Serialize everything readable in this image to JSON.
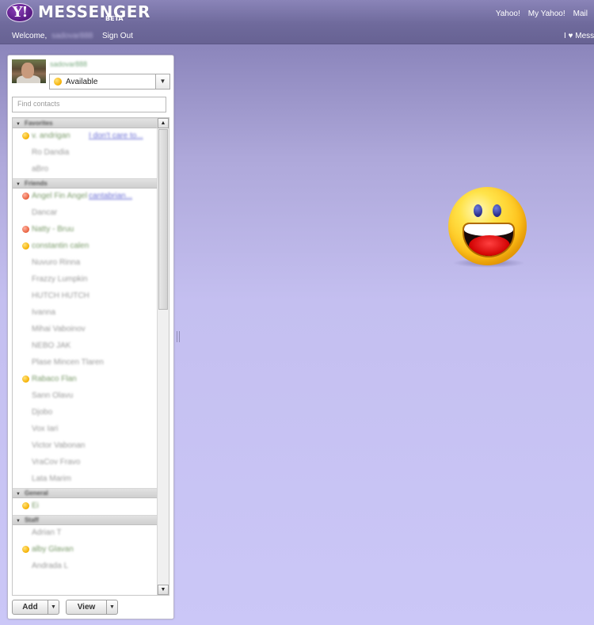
{
  "header": {
    "logo_mark": "Y!",
    "logo_text": "MESSENGER",
    "beta_label": "BETA",
    "links": [
      "Yahoo!",
      "My Yahoo!",
      "Mail"
    ],
    "welcome_label": "Welcome,",
    "username": "sadovar888",
    "sign_out": "Sign Out",
    "promo": "I ♥ Messenger"
  },
  "profile": {
    "display_name": "sadovar888",
    "status": "Available"
  },
  "search": {
    "placeholder": "Find contacts"
  },
  "groups": [
    {
      "name": "Favorites",
      "contacts": [
        {
          "name": "v. andrigan",
          "status": "online",
          "message": "I don't care to..."
        },
        {
          "name": "Ro Dandia",
          "status": "offline"
        },
        {
          "name": "aBro",
          "status": "offline"
        }
      ]
    },
    {
      "name": "Friends",
      "contacts": [
        {
          "name": "Angel Fin Angel",
          "status": "busy",
          "message": "cantabrian..."
        },
        {
          "name": "Dancar",
          "status": "offline"
        },
        {
          "name": "Natty - Bruu",
          "status": "busy"
        },
        {
          "name": "constantin calen",
          "status": "online"
        },
        {
          "name": "Nuvuro Rinna",
          "status": "offline"
        },
        {
          "name": "Frazzy Lumpkin",
          "status": "offline"
        },
        {
          "name": "HUTCH HUTCH",
          "status": "offline"
        },
        {
          "name": "Ivanna",
          "status": "offline"
        },
        {
          "name": "Mihai Vaboinov",
          "status": "offline"
        },
        {
          "name": "NEBO JAK",
          "status": "offline"
        },
        {
          "name": "Plase Mincen Tlaren",
          "status": "offline"
        },
        {
          "name": "Rabaco Flan",
          "status": "online"
        },
        {
          "name": "Sann Olavu",
          "status": "offline"
        },
        {
          "name": "Djobo",
          "status": "offline"
        },
        {
          "name": "Vox Iari",
          "status": "offline"
        },
        {
          "name": "Victor Vabonan",
          "status": "offline"
        },
        {
          "name": "VraCov Fravo",
          "status": "offline"
        },
        {
          "name": "Lata Marim",
          "status": "offline"
        }
      ]
    },
    {
      "name": "General",
      "contacts": [
        {
          "name": "Ei",
          "status": "online"
        }
      ]
    },
    {
      "name": "Staff",
      "contacts": [
        {
          "name": "Adrian T",
          "status": "offline"
        },
        {
          "name": "alby Glavan",
          "status": "online"
        },
        {
          "name": "Andrada L",
          "status": "offline"
        }
      ]
    }
  ],
  "buttons": {
    "add": "Add",
    "view": "View"
  },
  "icons": {
    "status": "status-dot-icon",
    "dropdown": "chevron-down-icon",
    "scroll_up": "triangle-up-icon",
    "scroll_down": "triangle-down-icon",
    "group_toggle": "triangle-down-icon",
    "mascot": "smiley-face-icon"
  },
  "colors": {
    "header_bg": "#6f6a9c",
    "page_bg": "#cbc7f7",
    "link": "#6b6fd6",
    "online": "#f5b000",
    "busy": "#e8603c"
  }
}
